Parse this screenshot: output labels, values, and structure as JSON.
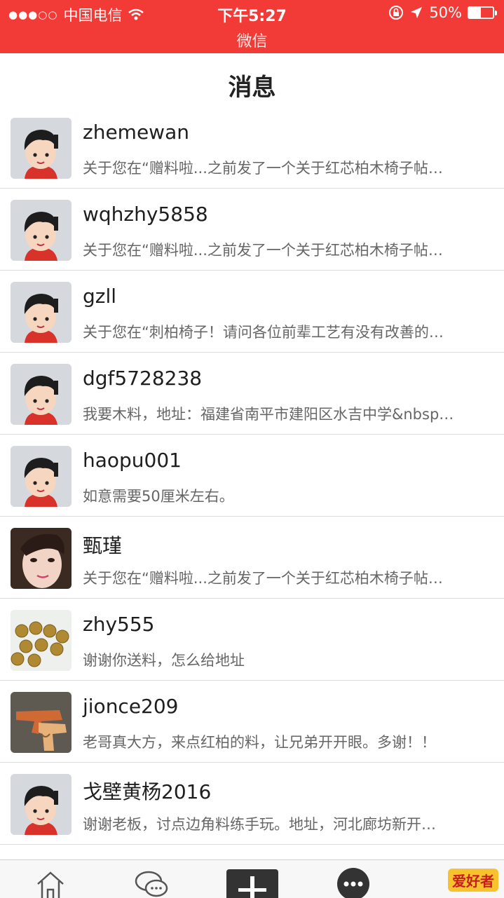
{
  "status_bar": {
    "signal": "●●●○○",
    "carrier": "中国电信",
    "time": "下午5:27",
    "battery_percent": "50%",
    "battery_level": 0.5,
    "back_app": "微信"
  },
  "header": {
    "title": "消息"
  },
  "messages": [
    {
      "name": "zhemewan",
      "preview": "关于您在“赠料啦...之前发了一个关于红芯柏木椅子帖…",
      "avatar": "cartoon"
    },
    {
      "name": "wqhzhy5858",
      "preview": "关于您在“赠料啦...之前发了一个关于红芯柏木椅子帖…",
      "avatar": "cartoon"
    },
    {
      "name": "gzll",
      "preview": "关于您在“刺柏椅子！请问各位前辈工艺有没有改善的…",
      "avatar": "cartoon"
    },
    {
      "name": "dgf5728238",
      "preview": "我要木料，地址：福建省南平市建阳区水吉中学&nbsp…",
      "avatar": "cartoon"
    },
    {
      "name": "haopu001",
      "preview": "如意需要50厘米左右。",
      "avatar": "cartoon"
    },
    {
      "name": "甄瑾",
      "preview": "关于您在“赠料啦...之前发了一个关于红芯柏木椅子帖…",
      "avatar": "face-photo"
    },
    {
      "name": "zhy555",
      "preview": "谢谢你送料，怎么给地址",
      "avatar": "beads-photo"
    },
    {
      "name": "jionce209",
      "preview": "老哥真大方，来点红柏的料，让兄弟开开眼。多谢！！",
      "avatar": "wood-gun-photo"
    },
    {
      "name": "戈壁黄杨2016",
      "preview": "谢谢老板，讨点边角料练手玩。地址，河北廊坊新开…",
      "avatar": "cartoon"
    }
  ],
  "tabbar": {
    "tabs": [
      "home-icon",
      "chat-bubbles-icon",
      "add-icon",
      "more-icon"
    ],
    "logo_text": "爱好者"
  },
  "colors": {
    "accent": "#f23a36",
    "divider": "#dcdcdc",
    "preview_text": "#666666"
  }
}
